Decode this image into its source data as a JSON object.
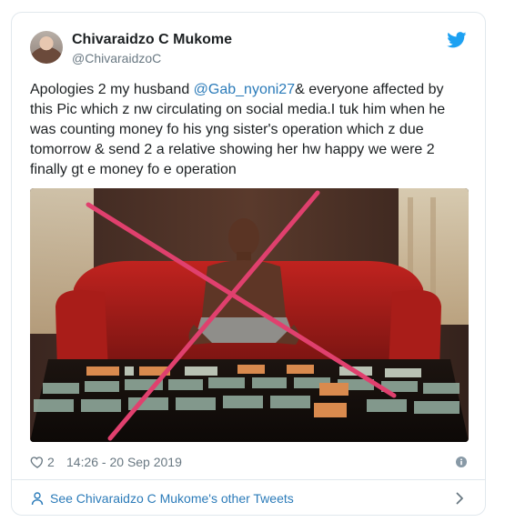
{
  "tweet": {
    "display_name": "Chivaraidzo C Mukome",
    "handle": "@ChivaraidzoC",
    "text_before": "Apologies 2 my husband ",
    "mention": "@Gab_nyoni27",
    "text_after": "& everyone affected by this Pic which z nw circulating on social media.I tuk him when he was counting money fo his yng sister's operation which z due tomorrow & send 2 a relative showing her hw happy we were 2 finally gt e money fo e operation",
    "likes": "2",
    "timestamp": "14:26 - 20 Sep 2019",
    "other_tweets_label": "See Chivaraidzo C Mukome's other Tweets"
  },
  "colors": {
    "link": "#2b7bb9",
    "twitter_blue": "#1da1f2",
    "muted": "#697882",
    "cross": "#e0406e"
  },
  "icons": [
    "avatar",
    "twitter-bird-icon",
    "heart-icon",
    "info-icon",
    "person-icon",
    "chevron-right-icon"
  ]
}
